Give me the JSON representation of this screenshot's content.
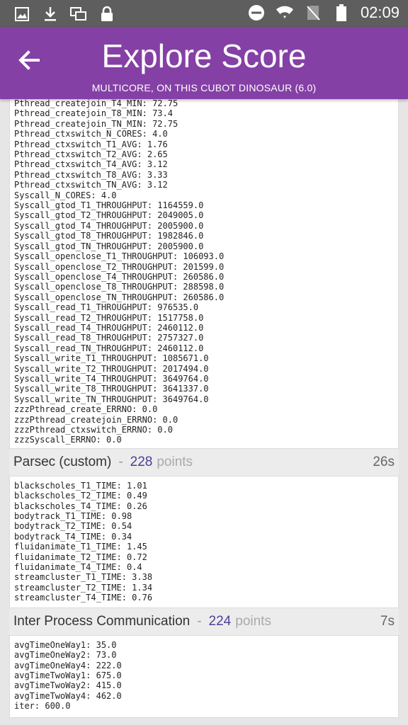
{
  "status_bar": {
    "time": "02:09",
    "left_icons": [
      "image-icon",
      "download-icon",
      "multiwindow-icon",
      "lock-icon"
    ],
    "right_icons": [
      "do-not-disturb-icon",
      "wifi-icon",
      "no-sim-icon",
      "battery-icon"
    ]
  },
  "app_bar": {
    "title": "Explore Score",
    "subtitle": "MULTICORE, ON THIS CUBOT DINOSAUR (6.0)",
    "back_icon": "arrow-back-icon",
    "color": "#8540a6"
  },
  "first_section_lines": [
    "Pthread_createjoin_T4_MIN: 72.75",
    "Pthread_createjoin_T8_MIN: 73.4",
    "Pthread_createjoin_TN_MIN: 72.75",
    "Pthread_ctxswitch_N_CORES: 4.0",
    "Pthread_ctxswitch_T1_AVG: 1.76",
    "Pthread_ctxswitch_T2_AVG: 2.65",
    "Pthread_ctxswitch_T4_AVG: 3.12",
    "Pthread_ctxswitch_T8_AVG: 3.33",
    "Pthread_ctxswitch_TN_AVG: 3.12",
    "Syscall_N_CORES: 4.0",
    "Syscall_gtod_T1_THROUGHPUT: 1164559.0",
    "Syscall_gtod_T2_THROUGHPUT: 2049005.0",
    "Syscall_gtod_T4_THROUGHPUT: 2005900.0",
    "Syscall_gtod_T8_THROUGHPUT: 1982846.0",
    "Syscall_gtod_TN_THROUGHPUT: 2005900.0",
    "Syscall_openclose_T1_THROUGHPUT: 106093.0",
    "Syscall_openclose_T2_THROUGHPUT: 201599.0",
    "Syscall_openclose_T4_THROUGHPUT: 260586.0",
    "Syscall_openclose_T8_THROUGHPUT: 288598.0",
    "Syscall_openclose_TN_THROUGHPUT: 260586.0",
    "Syscall_read_T1_THROUGHPUT: 976535.0",
    "Syscall_read_T2_THROUGHPUT: 1517758.0",
    "Syscall_read_T4_THROUGHPUT: 2460112.0",
    "Syscall_read_T8_THROUGHPUT: 2757327.0",
    "Syscall_read_TN_THROUGHPUT: 2460112.0",
    "Syscall_write_T1_THROUGHPUT: 1085671.0",
    "Syscall_write_T2_THROUGHPUT: 2017494.0",
    "Syscall_write_T4_THROUGHPUT: 3649764.0",
    "Syscall_write_T8_THROUGHPUT: 3641337.0",
    "Syscall_write_TN_THROUGHPUT: 3649764.0",
    "zzzPthread_create_ERRNO: 0.0",
    "zzzPthread_createjoin_ERRNO: 0.0",
    "zzzPthread_ctxswitch_ERRNO: 0.0",
    "zzzSyscall_ERRNO: 0.0"
  ],
  "sections": [
    {
      "name": "Parsec (custom)",
      "separator": "-",
      "points": "228",
      "points_label": "points",
      "time": "26s",
      "lines": [
        "blackscholes_T1_TIME: 1.01",
        "blackscholes_T2_TIME: 0.49",
        "blackscholes_T4_TIME: 0.26",
        "bodytrack_T1_TIME: 0.98",
        "bodytrack_T2_TIME: 0.54",
        "bodytrack_T4_TIME: 0.34",
        "fluidanimate_T1_TIME: 1.45",
        "fluidanimate_T2_TIME: 0.72",
        "fluidanimate_T4_TIME: 0.4",
        "streamcluster_T1_TIME: 3.38",
        "streamcluster_T2_TIME: 1.34",
        "streamcluster_T4_TIME: 0.76"
      ]
    },
    {
      "name": "Inter Process Communication",
      "separator": "-",
      "points": "224",
      "points_label": "points",
      "time": "7s",
      "lines": [
        "avgTimeOneWay1: 35.0",
        "avgTimeOneWay2: 73.0",
        "avgTimeOneWay4: 222.0",
        "avgTimeTwoWay1: 675.0",
        "avgTimeTwoWay2: 415.0",
        "avgTimeTwoWay4: 462.0",
        "iter: 600.0"
      ]
    }
  ]
}
